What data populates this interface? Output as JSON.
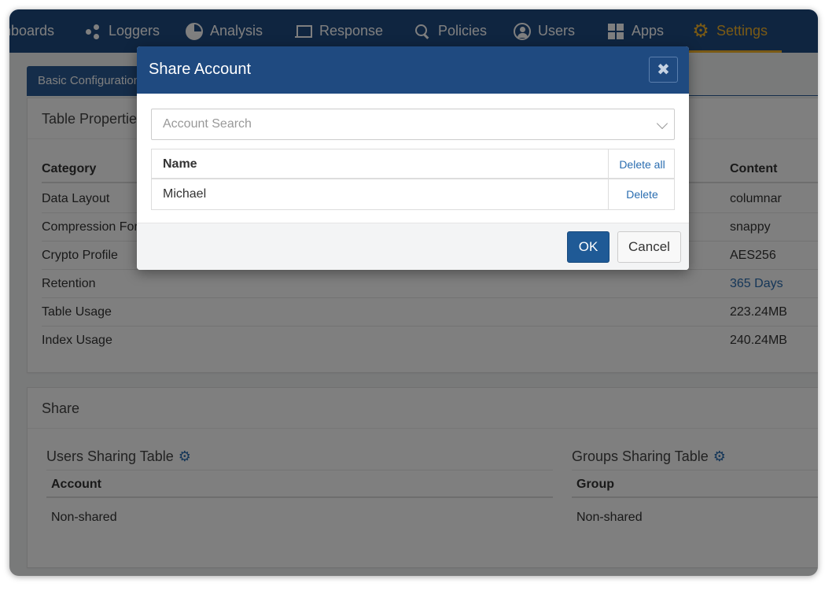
{
  "nav": {
    "items": [
      {
        "label": "hboards",
        "icon": "dashboard-icon"
      },
      {
        "label": "Loggers",
        "icon": "share-nodes-icon"
      },
      {
        "label": "Analysis",
        "icon": "pie-chart-icon"
      },
      {
        "label": "Response",
        "icon": "laptop-icon"
      },
      {
        "label": "Policies",
        "icon": "search-icon"
      },
      {
        "label": "Users",
        "icon": "user-circle-icon"
      },
      {
        "label": "Apps",
        "icon": "grid-icon"
      },
      {
        "label": "Settings",
        "icon": "gear-icon"
      }
    ],
    "active": "Settings",
    "accent_color": "#f5b52a",
    "bar_color": "#1f4a80"
  },
  "tab": {
    "label": "Basic Configuration"
  },
  "properties": {
    "title": "Table Properties",
    "col_category": "Category",
    "col_content": "Content",
    "rows": [
      {
        "category": "Data Layout",
        "content": "columnar"
      },
      {
        "category": "Compression Format",
        "content": "snappy"
      },
      {
        "category": "Crypto Profile",
        "content": "AES256"
      },
      {
        "category": "Retention",
        "content": "365 Days"
      },
      {
        "category": "Table Usage",
        "content": "223.24MB"
      },
      {
        "category": "Index Usage",
        "content": "240.24MB"
      }
    ]
  },
  "share": {
    "title": "Share",
    "users": {
      "title": "Users Sharing Table",
      "col": "Account",
      "value": "Non-shared"
    },
    "groups": {
      "title": "Groups Sharing Table",
      "col": "Group",
      "value": "Non-shared"
    }
  },
  "modal": {
    "title": "Share Account",
    "close_label": "✖",
    "search_placeholder": "Account Search",
    "col_name": "Name",
    "delete_all_label": "Delete all",
    "rows": [
      {
        "name": "Michael",
        "action": "Delete"
      }
    ],
    "ok_label": "OK",
    "cancel_label": "Cancel"
  }
}
